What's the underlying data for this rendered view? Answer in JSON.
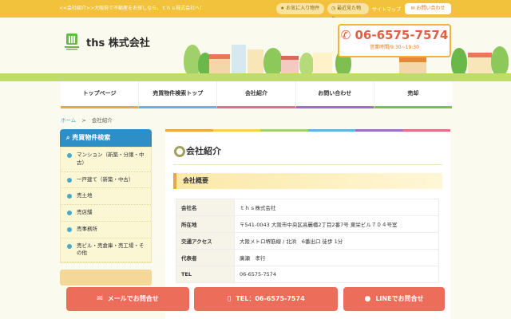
{
  "header": {
    "tagline": "<<会社紹介>>大阪府で不動産をお探しなら、ｔｈｓ株式会社へ！",
    "favorites": "お気に入り物件",
    "recent": "最近見た物件",
    "sitemap": "サイトマップ",
    "contact": "お問い合わせ",
    "company_name": "ths 株式会社",
    "phone": "06-6575-7574",
    "hours": "営業時間/9:30~19:30"
  },
  "nav": {
    "items": [
      "トップページ",
      "売買物件検索トップ",
      "会社紹介",
      "お問い合わせ",
      "売却"
    ],
    "colors": [
      "#f0a63c",
      "#5fb7e0",
      "#e96b8a",
      "#9c6fc4",
      "#7cc246"
    ]
  },
  "breadcrumb": {
    "home": "ホーム",
    "sep": ">",
    "current": "会社紹介"
  },
  "sidebar": {
    "title": "売買物件検索",
    "items": [
      "マンション（新築・分譲・中古）",
      "一戸建て（新築・中古）",
      "売土地",
      "売店舗",
      "売事務所",
      "売ビル・売倉庫・売工場・その他"
    ]
  },
  "main": {
    "title": "会社紹介",
    "section": "会社概要",
    "rows": [
      {
        "k": "会社名",
        "v": "ｔｈｓ株式会社"
      },
      {
        "k": "所在地",
        "v": "〒541-0043 大阪市中央区高麗橋2丁目2番7号 東栄ビル７０４号室"
      },
      {
        "k": "交通アクセス",
        "v": "大阪メトロ堺筋線 / 北浜　6番出口 徒歩 1分"
      },
      {
        "k": "代表者",
        "v": "廣瀬　孝行"
      },
      {
        "k": "TEL",
        "v": "06-6575-7574"
      }
    ]
  },
  "bottom": {
    "mail": "メールでお問合せ",
    "tel": "TEL：06-6575-7574",
    "line": "LINEでお問合せ"
  },
  "colors": {
    "accent": "#f2c23c",
    "sidebar": "#2e8fc6",
    "cta": "#ec6d5a"
  }
}
